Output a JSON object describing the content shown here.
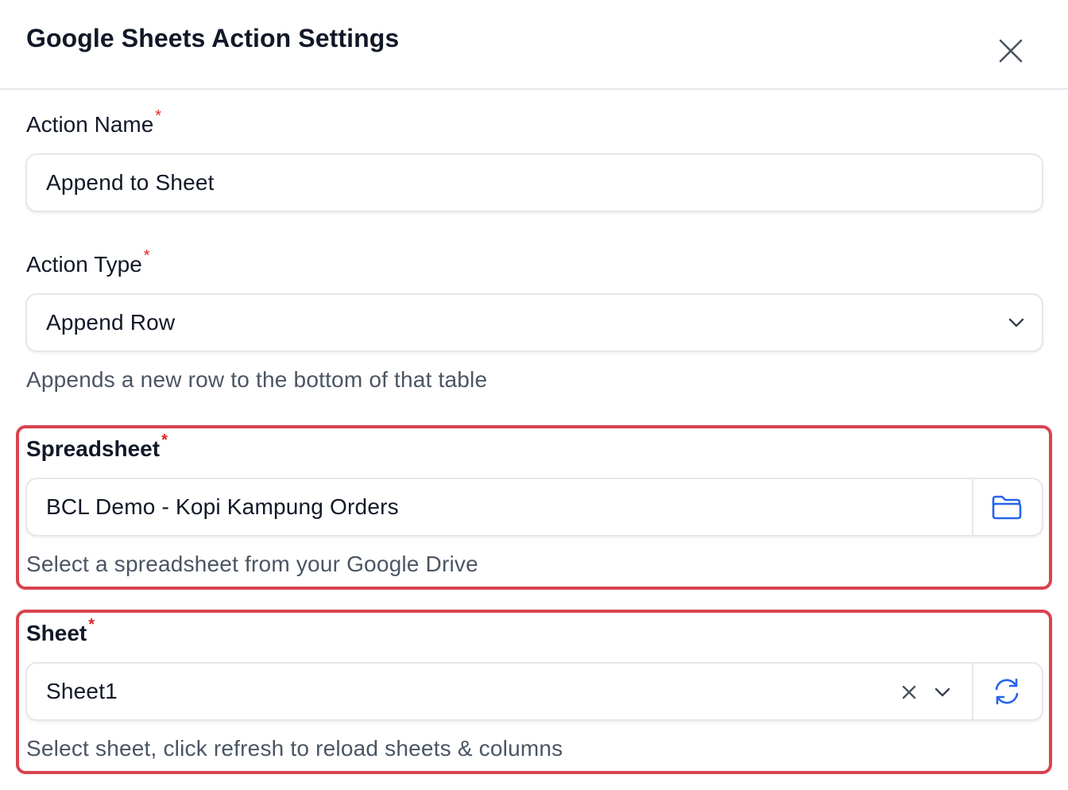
{
  "dialog": {
    "title": "Google Sheets Action Settings",
    "close_icon": "close-icon"
  },
  "action_name": {
    "label": "Action Name",
    "required_mark": "*",
    "value": "Append to Sheet"
  },
  "action_type": {
    "label": "Action Type",
    "required_mark": "*",
    "selected": "Append Row",
    "help": "Appends a new row to the bottom of that table",
    "icon": "chevron-down-icon"
  },
  "spreadsheet": {
    "label": "Spreadsheet",
    "required_mark": "*",
    "value": "BCL Demo - Kopi Kampung Orders",
    "help": "Select a spreadsheet from your Google Drive",
    "icon": "folder-icon"
  },
  "sheet": {
    "label": "Sheet",
    "required_mark": "*",
    "selected": "Sheet1",
    "help": "Select sheet, click refresh to reload sheets & columns",
    "icons": [
      "clear-icon",
      "chevron-down-icon",
      "refresh-icon"
    ]
  },
  "colors": {
    "required": "#dc2626",
    "highlight_border": "#d9434f",
    "icon_accent": "#2563eb"
  }
}
